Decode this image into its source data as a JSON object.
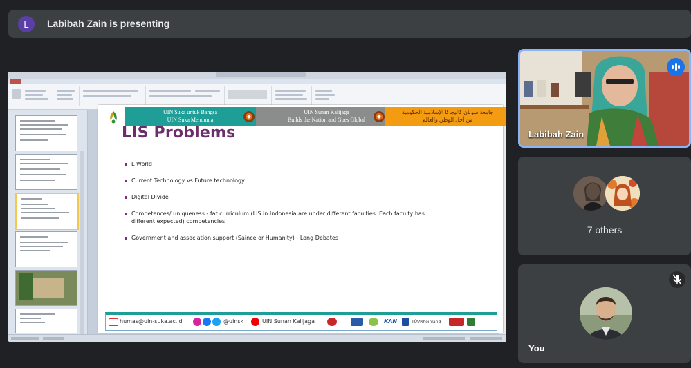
{
  "banner": {
    "avatar_letter": "L",
    "text": "Labibah Zain is presenting",
    "avatar_color": "#5b3fa9"
  },
  "slide": {
    "header": {
      "left": "UIN Suka untuk Bangsa\nUIN Suka Mendunia",
      "middle": "UIN Sunan Kalijaga\nBuilds the Nation and Goes Global",
      "right": "جامعة سونان كاليجاكا الإسلامية الحكومية\nمن أجل الوطن والعالم"
    },
    "title": "LIS Problems",
    "bullets": [
      "L World",
      "Current Technology vs Future technology",
      "Digital Divide",
      "Competences/ uniqueness - fat curriculum (LIS in Indonesia are under different faculties. Each faculty has different expected) competencies",
      "Government and association support (Saince or Humanity) - Long Debates"
    ],
    "footer": {
      "email": "humas@uin-suka.ac.id",
      "social": "@uinsk",
      "youtube": "UIN Sunan Kalijaga",
      "kan": "KAN",
      "tuv": "TÜVRheinland"
    }
  },
  "participants": {
    "presenter": {
      "name": "Labibah Zain"
    },
    "others": {
      "label": "7 others"
    },
    "self": {
      "name": "You"
    }
  },
  "colors": {
    "background": "#202124",
    "tile": "#3c4043",
    "active_border": "#8ab4f8",
    "speaking_blue": "#1a73e8",
    "slide_title": "#6c2d6b"
  }
}
